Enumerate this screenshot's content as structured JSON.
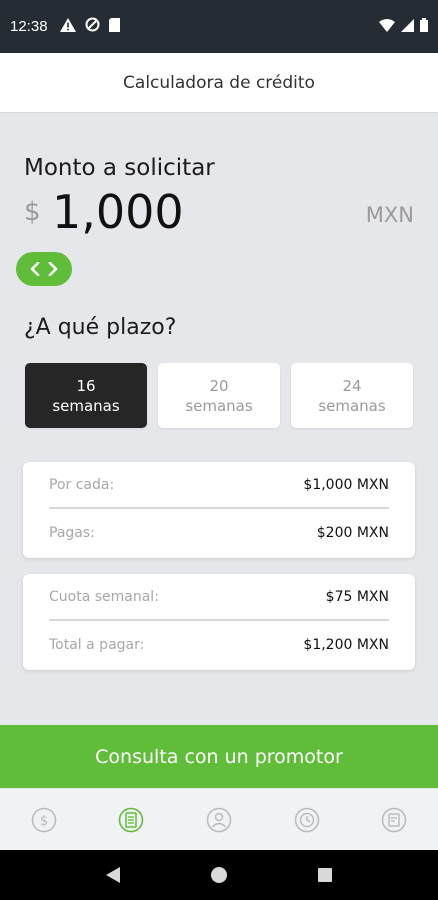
{
  "status_bar": {
    "time": "12:38"
  },
  "header": {
    "title": "Calculadora de crédito"
  },
  "amount": {
    "label": "Monto a solicitar",
    "currency_sign": "$",
    "value": "1,000",
    "currency_code": "MXN"
  },
  "term": {
    "label": "¿A qué plazo?",
    "options": [
      {
        "number": "16",
        "unit": "semanas",
        "selected": true
      },
      {
        "number": "20",
        "unit": "semanas",
        "selected": false
      },
      {
        "number": "24",
        "unit": "semanas",
        "selected": false
      }
    ]
  },
  "summary_1": {
    "rows": [
      {
        "label": "Por cada:",
        "value": "$1,000 MXN"
      },
      {
        "label": "Pagas:",
        "value": "$200 MXN"
      }
    ]
  },
  "summary_2": {
    "rows": [
      {
        "label": "Cuota semanal:",
        "value": "$75 MXN"
      },
      {
        "label": "Total a pagar:",
        "value": "$1,200 MXN"
      }
    ]
  },
  "cta": {
    "label": "Consulta con un promotor"
  },
  "bottom_nav": {
    "items": [
      {
        "icon": "dollar-icon",
        "active": false
      },
      {
        "icon": "calculator-icon",
        "active": true
      },
      {
        "icon": "profile-icon",
        "active": false
      },
      {
        "icon": "history-icon",
        "active": false
      },
      {
        "icon": "edit-icon",
        "active": false
      }
    ]
  },
  "colors": {
    "accent": "#5fbd3a",
    "status_bar": "#252c33",
    "selected_term": "#262626"
  }
}
